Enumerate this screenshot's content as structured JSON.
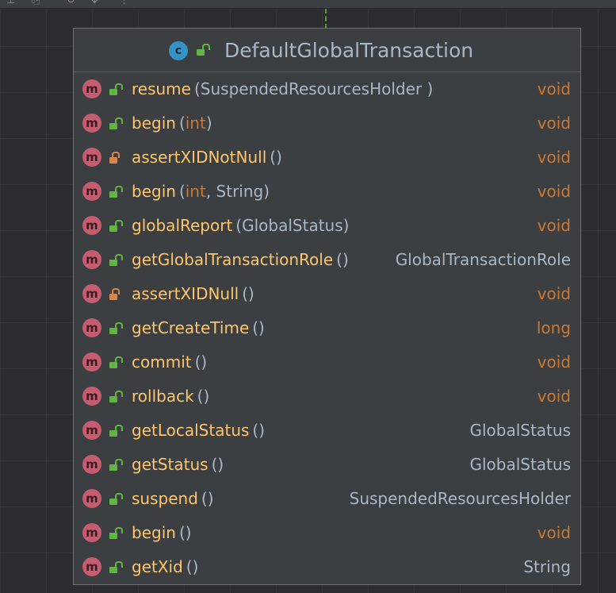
{
  "diagram": {
    "class_icon_letter": "c",
    "class_name": "DefaultGlobalTransaction",
    "method_icon_letter": "m",
    "colors": {
      "method_name": "#ffc66d",
      "primitive_type": "#cc7832",
      "object_type": "#a9b7c6",
      "public_lock": "#62b543",
      "private_lock": "#d9864e",
      "method_icon": "#c65c70",
      "class_icon": "#3592c4"
    },
    "methods": [
      {
        "name": "resume",
        "open": "(",
        "params": [
          {
            "type": "SuspendedResourcesHolder",
            "primitive": false
          }
        ],
        "close": " )",
        "return_type": "void",
        "return_primitive": true,
        "visibility": "public"
      },
      {
        "name": "begin",
        "open": "(",
        "params": [
          {
            "type": "int",
            "primitive": true
          }
        ],
        "close": ")",
        "return_type": "void",
        "return_primitive": true,
        "visibility": "public"
      },
      {
        "name": "assertXIDNotNull",
        "open": "()",
        "params": [],
        "close": "",
        "return_type": "void",
        "return_primitive": true,
        "visibility": "private"
      },
      {
        "name": "begin",
        "open": "(",
        "params": [
          {
            "type": "int",
            "primitive": true
          },
          {
            "type": "String",
            "primitive": false
          }
        ],
        "close": ")",
        "return_type": "void",
        "return_primitive": true,
        "visibility": "public"
      },
      {
        "name": "globalReport",
        "open": "(",
        "params": [
          {
            "type": "GlobalStatus",
            "primitive": false
          }
        ],
        "close": ")",
        "return_type": "void",
        "return_primitive": true,
        "visibility": "public"
      },
      {
        "name": "getGlobalTransactionRole",
        "open": "()",
        "params": [],
        "close": "",
        "return_type": "GlobalTransactionRole",
        "return_primitive": false,
        "visibility": "public"
      },
      {
        "name": "assertXIDNull",
        "open": "()",
        "params": [],
        "close": "",
        "return_type": "void",
        "return_primitive": true,
        "visibility": "private"
      },
      {
        "name": "getCreateTime",
        "open": "()",
        "params": [],
        "close": "",
        "return_type": "long",
        "return_primitive": true,
        "visibility": "public"
      },
      {
        "name": "commit",
        "open": "()",
        "params": [],
        "close": "",
        "return_type": "void",
        "return_primitive": true,
        "visibility": "public"
      },
      {
        "name": "rollback",
        "open": "()",
        "params": [],
        "close": "",
        "return_type": "void",
        "return_primitive": true,
        "visibility": "public"
      },
      {
        "name": "getLocalStatus",
        "open": "()",
        "params": [],
        "close": "",
        "return_type": "GlobalStatus",
        "return_primitive": false,
        "visibility": "public"
      },
      {
        "name": "getStatus",
        "open": "()",
        "params": [],
        "close": "",
        "return_type": "GlobalStatus",
        "return_primitive": false,
        "visibility": "public"
      },
      {
        "name": "suspend",
        "open": "()",
        "params": [],
        "close": "",
        "return_type": "SuspendedResourcesHolder",
        "return_primitive": false,
        "visibility": "public"
      },
      {
        "name": "begin",
        "open": "()",
        "params": [],
        "close": "",
        "return_type": "void",
        "return_primitive": true,
        "visibility": "public"
      },
      {
        "name": "getXid",
        "open": "()",
        "params": [],
        "close": "",
        "return_type": "String",
        "return_primitive": false,
        "visibility": "public"
      }
    ]
  }
}
